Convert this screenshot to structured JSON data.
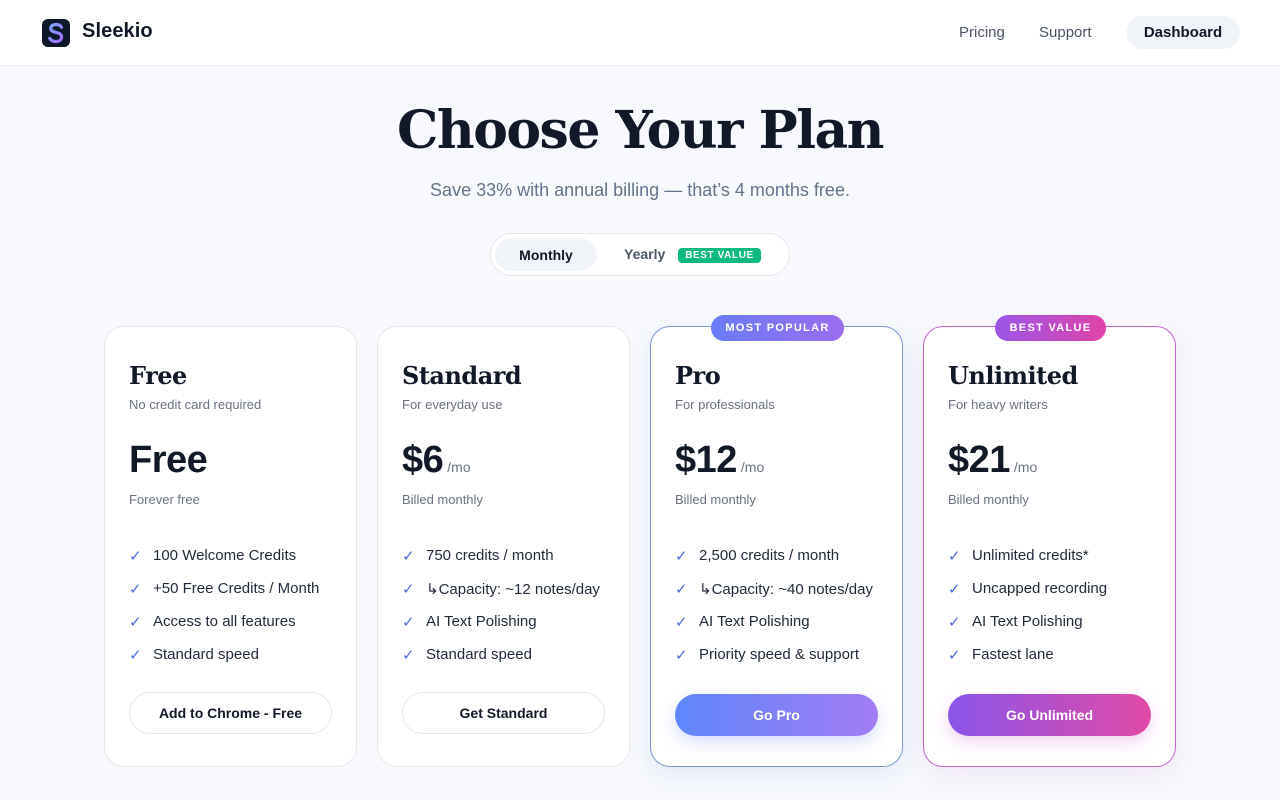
{
  "header": {
    "brand": "Sleekio",
    "logo_letter": "S",
    "nav": {
      "pricing": "Pricing",
      "support": "Support",
      "dashboard": "Dashboard"
    }
  },
  "hero": {
    "title": "Choose Your Plan",
    "subtitle": "Save 33% with annual billing — that’s 4 months free."
  },
  "billing_toggle": {
    "monthly": "Monthly",
    "yearly": "Yearly",
    "yearly_badge": "BEST VALUE",
    "selected": "Monthly"
  },
  "plans": [
    {
      "name": "Free",
      "description": "No credit card required",
      "price": "Free",
      "period": "",
      "billing": "Forever free",
      "features": [
        "100 Welcome Credits",
        "+50 Free Credits / Month",
        "Access to all features",
        "Standard speed"
      ],
      "cta": "Add to Chrome - Free"
    },
    {
      "name": "Standard",
      "description": "For everyday use",
      "price": "$6",
      "period": "/mo",
      "billing": "Billed monthly",
      "features": [
        "750 credits / month",
        "↳Capacity: ~12 notes/day",
        "AI Text Polishing",
        "Standard speed"
      ],
      "cta": "Get Standard"
    },
    {
      "name": "Pro",
      "ribbon": "MOST POPULAR",
      "description": "For professionals",
      "price": "$12",
      "period": "/mo",
      "billing": "Billed monthly",
      "features": [
        "2,500 credits / month",
        "↳Capacity: ~40 notes/day",
        "AI Text Polishing",
        "Priority speed & support"
      ],
      "cta": "Go Pro"
    },
    {
      "name": "Unlimited",
      "ribbon": "BEST VALUE",
      "description": "For heavy writers",
      "price": "$21",
      "period": "/mo",
      "billing": "Billed monthly",
      "features": [
        "Unlimited credits*",
        "Uncapped recording",
        "AI Text Polishing",
        "Fastest lane"
      ],
      "cta": "Go Unlimited"
    }
  ],
  "check_glyph": "✓",
  "colors": {
    "accent_blue": "#5f86fb",
    "accent_purple": "#a37cf4",
    "accent_pink": "#e14aa6",
    "badge_green": "#10b981"
  }
}
